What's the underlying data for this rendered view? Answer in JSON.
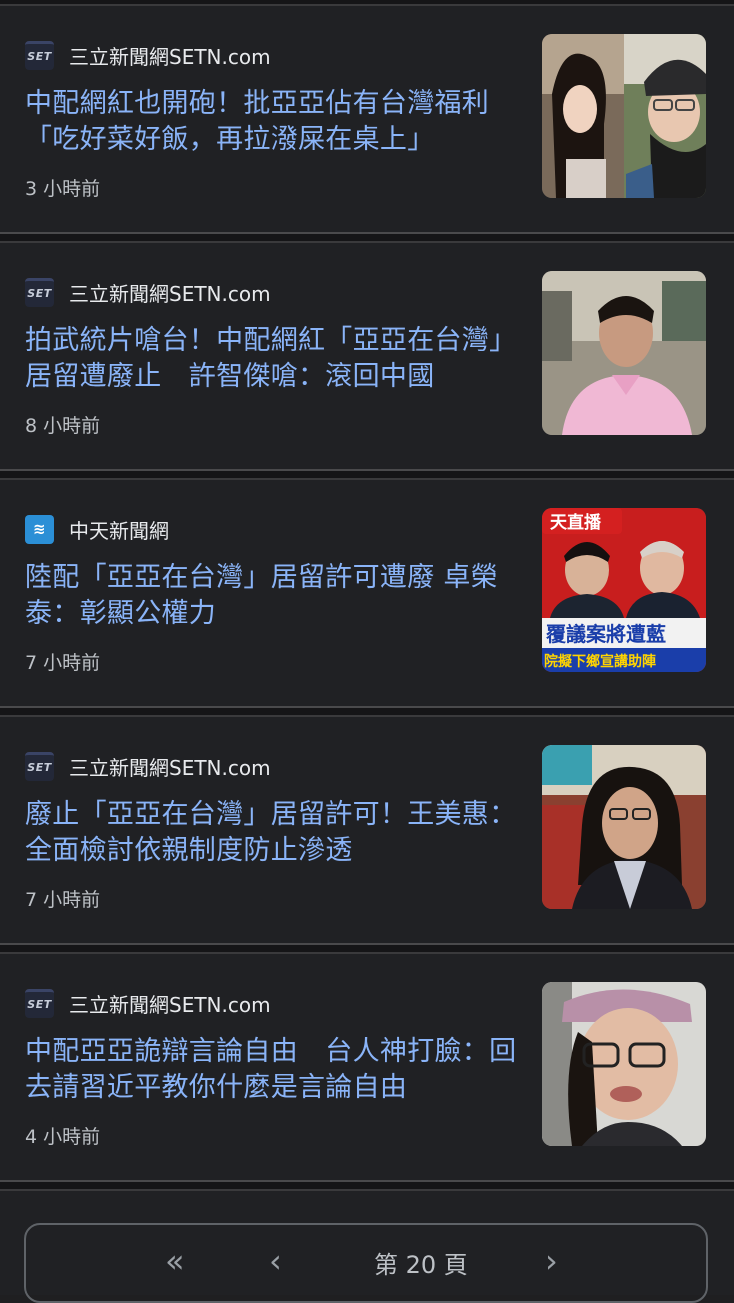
{
  "articles": [
    {
      "source": "三立新聞網SETN.com",
      "logo_text": "SET",
      "headline": "中配網紅也開砲！批亞亞佔有台灣福利「吃好菜好飯，再拉潑屎在桌上」",
      "time": "3 小時前"
    },
    {
      "source": "三立新聞網SETN.com",
      "logo_text": "SET",
      "headline": "拍武統片嗆台！中配網紅「亞亞在台灣」居留遭廢止　許智傑嗆：滾回中國",
      "time": "8 小時前"
    },
    {
      "source": "中天新聞網",
      "logo_text": "",
      "headline": "陸配「亞亞在台灣」居留許可遭廢 卓榮泰：彰顯公權力",
      "time": "7 小時前",
      "thumb_text": [
        "天直播",
        "覆議案將遭藍",
        "院擬下鄉宣講助陣"
      ]
    },
    {
      "source": "三立新聞網SETN.com",
      "logo_text": "SET",
      "headline": "廢止「亞亞在台灣」居留許可！王美惠：全面檢討依親制度防止滲透",
      "time": "7 小時前"
    },
    {
      "source": "三立新聞網SETN.com",
      "logo_text": "SET",
      "headline": "中配亞亞詭辯言論自由　台人神打臉：回去請習近平教你什麼是言論自由",
      "time": "4 小時前"
    }
  ],
  "pager": {
    "first": "«",
    "prev": "‹",
    "label": "第 20 頁",
    "next": "›"
  },
  "colors": {
    "background": "#202124",
    "headline": "#8ab4f8",
    "text": "#e8eaed",
    "muted": "#bdc1c6"
  }
}
